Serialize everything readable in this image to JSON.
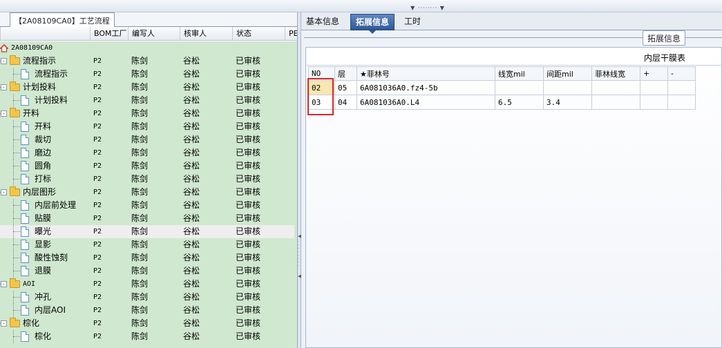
{
  "left_panel": {
    "tab_title": "【2A08109CA0】工艺流程",
    "columns": [
      "BOM工厂",
      "编写人",
      "核审人",
      "状态",
      "PE"
    ],
    "root_label": "2A08109CA0",
    "rows": [
      {
        "name": "流程指示",
        "type": "folder",
        "bom": "P2",
        "author": "陈剑",
        "reviewer": "谷松",
        "status": "已审核"
      },
      {
        "name": "流程指示",
        "type": "file",
        "bom": "P2",
        "author": "陈剑",
        "reviewer": "谷松",
        "status": "已审核"
      },
      {
        "name": "计划投料",
        "type": "folder",
        "bom": "P2",
        "author": "陈剑",
        "reviewer": "谷松",
        "status": "已审核"
      },
      {
        "name": "计划投料",
        "type": "file",
        "bom": "P2",
        "author": "陈剑",
        "reviewer": "谷松",
        "status": "已审核"
      },
      {
        "name": "开料",
        "type": "folder",
        "bom": "P2",
        "author": "陈剑",
        "reviewer": "谷松",
        "status": "已审核"
      },
      {
        "name": "开料",
        "type": "file",
        "bom": "P2",
        "author": "陈剑",
        "reviewer": "谷松",
        "status": "已审核"
      },
      {
        "name": "裁切",
        "type": "file",
        "bom": "P2",
        "author": "陈剑",
        "reviewer": "谷松",
        "status": "已审核"
      },
      {
        "name": "磨边",
        "type": "file",
        "bom": "P2",
        "author": "陈剑",
        "reviewer": "谷松",
        "status": "已审核"
      },
      {
        "name": "圆角",
        "type": "file",
        "bom": "P2",
        "author": "陈剑",
        "reviewer": "谷松",
        "status": "已审核"
      },
      {
        "name": "打标",
        "type": "file",
        "bom": "P2",
        "author": "陈剑",
        "reviewer": "谷松",
        "status": "已审核"
      },
      {
        "name": "内层图形",
        "type": "folder",
        "bom": "P2",
        "author": "陈剑",
        "reviewer": "谷松",
        "status": "已审核"
      },
      {
        "name": "内层前处理",
        "type": "file",
        "bom": "P2",
        "author": "陈剑",
        "reviewer": "谷松",
        "status": "已审核"
      },
      {
        "name": "贴膜",
        "type": "file",
        "bom": "P2",
        "author": "陈剑",
        "reviewer": "谷松",
        "status": "已审核"
      },
      {
        "name": "曝光",
        "type": "file",
        "bom": "P2",
        "author": "陈剑",
        "reviewer": "谷松",
        "status": "已审核",
        "selected": true
      },
      {
        "name": "显影",
        "type": "file",
        "bom": "P2",
        "author": "陈剑",
        "reviewer": "谷松",
        "status": "已审核"
      },
      {
        "name": "酸性蚀刻",
        "type": "file",
        "bom": "P2",
        "author": "陈剑",
        "reviewer": "谷松",
        "status": "已审核"
      },
      {
        "name": "退膜",
        "type": "file",
        "bom": "P2",
        "author": "陈剑",
        "reviewer": "谷松",
        "status": "已审核"
      },
      {
        "name": "AOI",
        "type": "folder",
        "bom": "P2",
        "author": "陈剑",
        "reviewer": "谷松",
        "status": "已审核"
      },
      {
        "name": "冲孔",
        "type": "file",
        "bom": "P2",
        "author": "陈剑",
        "reviewer": "谷松",
        "status": "已审核"
      },
      {
        "name": "内层AOI",
        "type": "file",
        "bom": "P2",
        "author": "陈剑",
        "reviewer": "谷松",
        "status": "已审核"
      },
      {
        "name": "棕化",
        "type": "folder",
        "bom": "P2",
        "author": "陈剑",
        "reviewer": "谷松",
        "status": "已审核"
      },
      {
        "name": "棕化",
        "type": "file",
        "bom": "P2",
        "author": "陈剑",
        "reviewer": "谷松",
        "status": "已审核"
      }
    ]
  },
  "right_panel": {
    "tabs": [
      {
        "label": "基本信息",
        "active": false
      },
      {
        "label": "拓展信息",
        "active": true
      },
      {
        "label": "工时",
        "active": false
      }
    ],
    "group_title": "拓展信息",
    "grid_caption": "内层干膜表",
    "grid": {
      "headers": [
        "NO",
        "层",
        "★菲林号",
        "线宽mil",
        "间距mil",
        "菲林线宽",
        "+",
        "-"
      ],
      "rows": [
        [
          "02",
          "05",
          "6A081036A0.fz4-5b",
          "",
          "",
          "",
          "",
          ""
        ],
        [
          "03",
          "04",
          "6A081036A0.L4",
          "6.5",
          "3.4",
          "",
          "",
          ""
        ]
      ]
    }
  },
  "colors": {
    "tree_bg": "#cfe8cf",
    "active_tab": "#2f5896",
    "highlight_box": "#d9262a",
    "current_cell": "#f9e6b0"
  }
}
